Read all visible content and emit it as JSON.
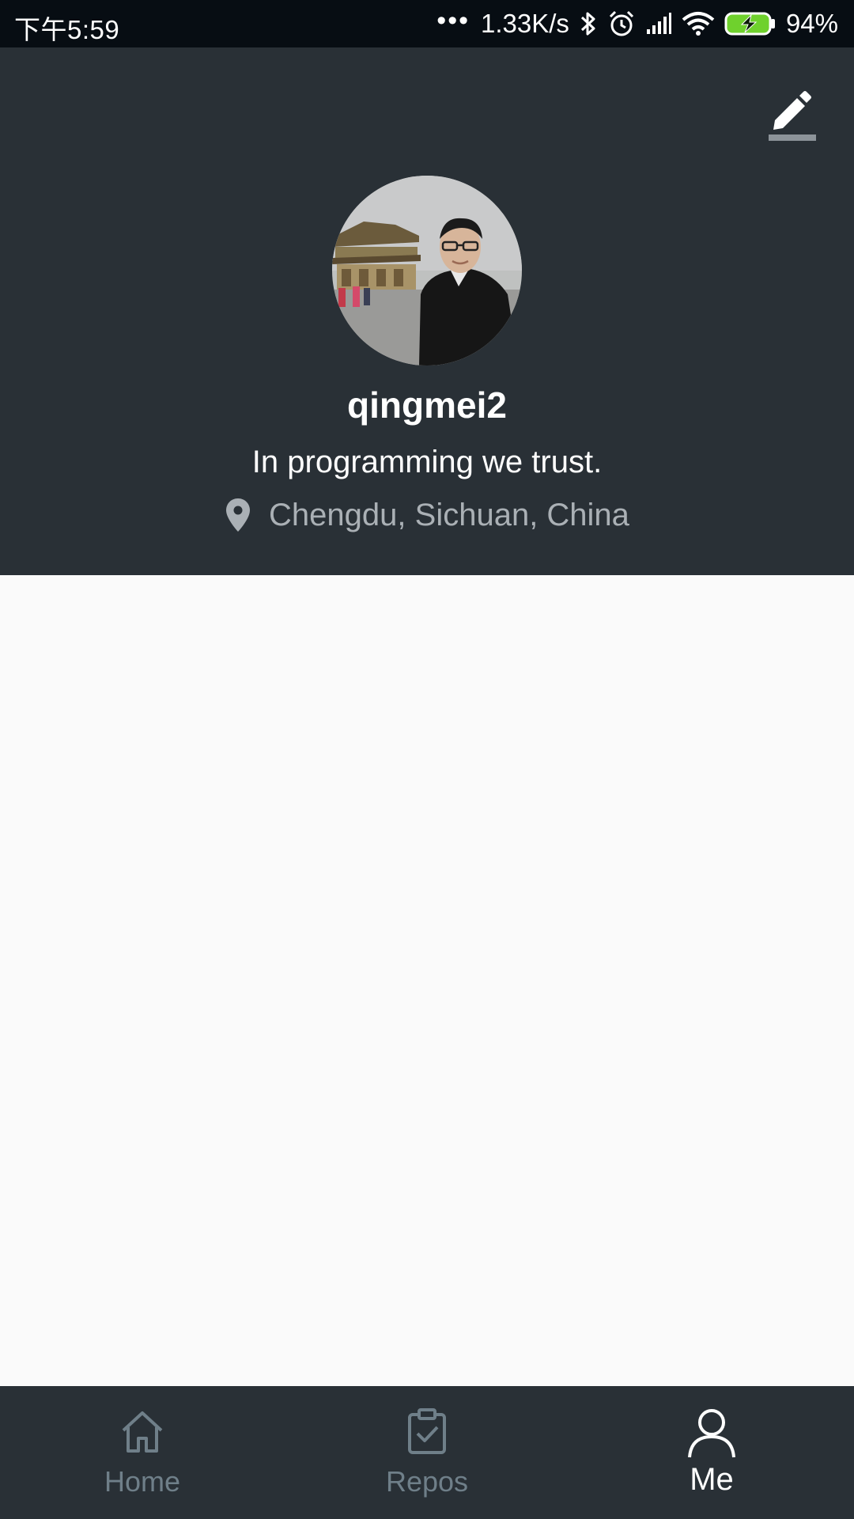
{
  "status_bar": {
    "time": "下午5:59",
    "dots": "•••",
    "network_speed": "1.33K/s",
    "battery_percent": "94%",
    "battery_color": "#6fd12d",
    "icons": [
      "bluetooth-icon",
      "alarm-icon",
      "signal-icon",
      "wifi-icon",
      "battery-charging-icon"
    ]
  },
  "profile": {
    "username": "qingmei2",
    "bio": "In programming we trust.",
    "location": "Chengdu, Sichuan, China",
    "header_color": "#293036",
    "edit_icon": "edit-pencil-icon",
    "location_icon": "location-pin-icon"
  },
  "bottom_nav": {
    "items": [
      {
        "label": "Home",
        "icon": "home-icon",
        "active": false
      },
      {
        "label": "Repos",
        "icon": "clipboard-check-icon",
        "active": false
      },
      {
        "label": "Me",
        "icon": "person-icon",
        "active": true
      }
    ]
  }
}
